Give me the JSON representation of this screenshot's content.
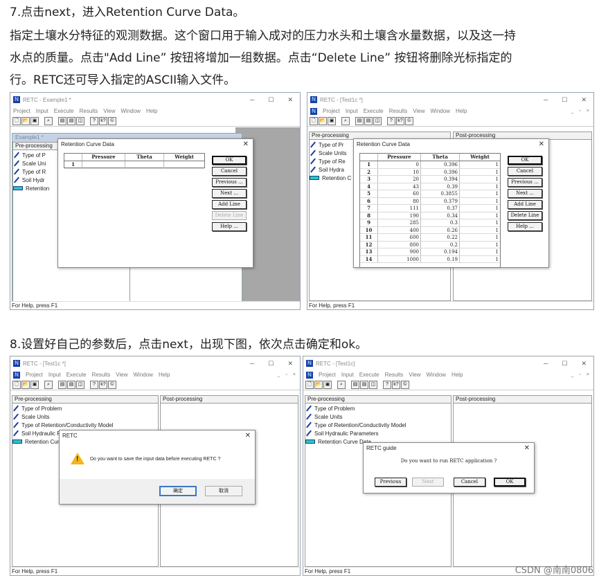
{
  "step7": {
    "heading": "7.点击next，进入Retention Curve Data。",
    "line1": "指定土壤水分特征的观测数据。这个窗口用于输入成对的压力水头和土壤含水量数据，以及这一持",
    "line2": "水点的质量。点击\"Add Line” 按钮将增加一组数据。点击“Delete Line” 按钮将删除光标指定的",
    "line3": "行。RETC还可导入指定的ASCII输入文件。"
  },
  "step8": {
    "heading": "8.设置好自己的参数后，点击next，出现下图，依次点击确定和ok。"
  },
  "menu": [
    "Project",
    "Input",
    "Execute",
    "Results",
    "View",
    "Window",
    "Help"
  ],
  "mdi_controls": [
    "_",
    "▫",
    "×"
  ],
  "window_controls": [
    "─",
    "☐",
    "✕"
  ],
  "toolbar_icons": [
    "new-icon",
    "open-icon",
    "save-icon",
    "print-icon",
    "preview-icon",
    "tile-icon",
    "cascade-icon",
    "split-icon",
    "help-icon",
    "context-help-icon",
    "about-icon"
  ],
  "toolbar_glyphs": [
    "🗋",
    "📂",
    "▣",
    "▣",
    "⌕",
    "▤",
    "▤",
    "◫",
    "?",
    "k?",
    "©"
  ],
  "status_text": "For Help, press F1",
  "panels": {
    "pre": "Pre-processing",
    "post": "Post-processing"
  },
  "tree_items": [
    "Type of Problem",
    "Scale Units",
    "Type of Retention/Conductivity Model",
    "Soil Hydraulic Parameters",
    "Retention Curve Data"
  ],
  "tree_items_short1": [
    "Type of P",
    "Scale Uni",
    "Type of R",
    "Soil Hydr",
    "Retention"
  ],
  "tree_items_short2": [
    "Type of Pr",
    "Scale Units",
    "Type of Re",
    "Soil Hydra",
    "Retention C"
  ],
  "win1": {
    "title": "RETC - Example1 *",
    "child_title": "Example1 *"
  },
  "win2": {
    "title": "RETC - [Test1c *]"
  },
  "win3": {
    "title": "RETC - [Test1c *]"
  },
  "win4": {
    "title": "RETC - [Test1c]"
  },
  "retention_dialog": {
    "title": "Retention Curve Data",
    "columns": [
      "Pressure",
      "Theta",
      "Weight"
    ],
    "buttons": {
      "ok": "OK",
      "cancel": "Cancel",
      "previous": "Previous ...",
      "next": "Next ...",
      "add": "Add Line",
      "delete": "Delete Line",
      "help": "Help ..."
    }
  },
  "empty_row": "1",
  "rows": [
    {
      "n": "1",
      "p": "0",
      "t": "0.396",
      "w": "1"
    },
    {
      "n": "2",
      "p": "10",
      "t": "0.396",
      "w": "1"
    },
    {
      "n": "3",
      "p": "20",
      "t": "0.394",
      "w": "1"
    },
    {
      "n": "4",
      "p": "43",
      "t": "0.39",
      "w": "1"
    },
    {
      "n": "5",
      "p": "60",
      "t": "0.3855",
      "w": "1"
    },
    {
      "n": "6",
      "p": "80",
      "t": "0.379",
      "w": "1"
    },
    {
      "n": "7",
      "p": "111",
      "t": "0.37",
      "w": "1"
    },
    {
      "n": "8",
      "p": "190",
      "t": "0.34",
      "w": "1"
    },
    {
      "n": "9",
      "p": "285",
      "t": "0.3",
      "w": "1"
    },
    {
      "n": "10",
      "p": "400",
      "t": "0.26",
      "w": "1"
    },
    {
      "n": "11",
      "p": "600",
      "t": "0.22",
      "w": "1"
    },
    {
      "n": "12",
      "p": "800",
      "t": "0.2",
      "w": "1"
    },
    {
      "n": "13",
      "p": "900",
      "t": "0.194",
      "w": "1"
    },
    {
      "n": "14",
      "p": "1000",
      "t": "0.19",
      "w": "1"
    }
  ],
  "save_dialog": {
    "title": "RETC",
    "message": "Do you want to save the input data before executing RETC ?",
    "ok": "确定",
    "cancel": "取消"
  },
  "guide_dialog": {
    "title": "RETC guide",
    "message": "Do you want to run RETC application ?",
    "previous": "Previous",
    "next": "Next",
    "cancel": "Cancel",
    "ok": "OK"
  },
  "watermark": "CSDN @南南0806"
}
